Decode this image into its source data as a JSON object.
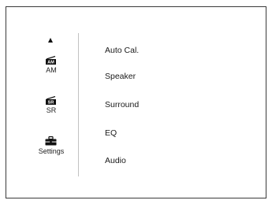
{
  "sidebar": {
    "items": [
      {
        "icon": "am-radio-icon",
        "icon_text": "AM",
        "label": "AM"
      },
      {
        "icon": "sr-surround-icon",
        "icon_text": "SR",
        "label": "SR"
      },
      {
        "icon": "toolbox-settings-icon",
        "label": "Settings"
      }
    ]
  },
  "menu": {
    "items": [
      {
        "label": "Auto Cal."
      },
      {
        "label": "Speaker"
      },
      {
        "label": "Surround"
      },
      {
        "label": "EQ"
      },
      {
        "label": "Audio"
      }
    ]
  }
}
